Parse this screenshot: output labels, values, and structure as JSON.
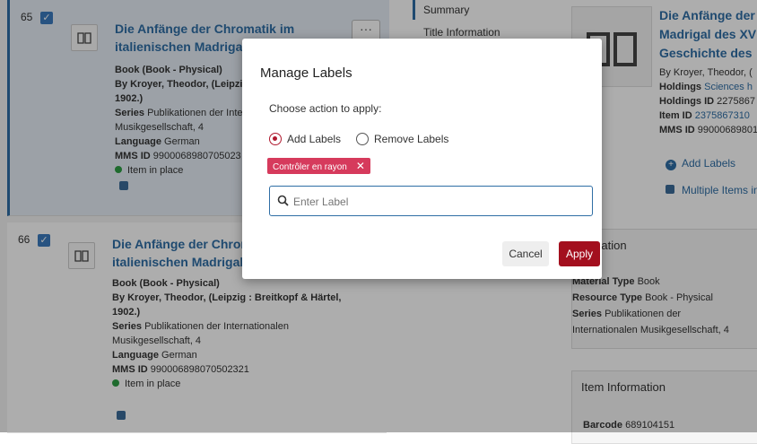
{
  "results": [
    {
      "number": "65",
      "title_line1": "Die Anfänge der Chromatik im",
      "title_line2": "italienischen Madrigal de",
      "line1": "Book (Book - Physical)",
      "line2": "By Kroyer, Theodor, (Leipzig :",
      "line3": "1902.)",
      "series_label": "Series",
      "series_value": "Publikationen der Intern",
      "series_cont": "Musikgesellschaft, 4",
      "language_label": "Language",
      "language_value": "German",
      "mms_label": "MMS ID",
      "mms_value": "9900068980705023",
      "status": "Item in place",
      "more_label": "···"
    },
    {
      "number": "66",
      "title_line1": "Die Anfänge der Chromat",
      "title_line2": "italienischen Madrigal de",
      "line1": "Book (Book - Physical)",
      "line2": "By Kroyer, Theodor, (Leipzig : Breitkopf & Härtel,",
      "line3": "1902.)",
      "series_label": "Series",
      "series_value": "Publikationen der Internationalen",
      "series_cont": "Musikgesellschaft, 4",
      "language_label": "Language",
      "language_value": "German",
      "mms_label": "MMS ID",
      "mms_value": "990006898070502321",
      "status": "Item in place"
    }
  ],
  "menu": {
    "items": [
      "Summary",
      "Title Information"
    ]
  },
  "detail": {
    "title_line1": "Die Anfänge der",
    "title_line2": "Madrigal des XV",
    "title_line3": "Geschichte des",
    "by_line": "By Kroyer, Theodor, (",
    "holdings_label": "Holdings",
    "holdings_value": "Sciences h",
    "holdings_id_label": "Holdings ID",
    "holdings_id_value": "2275867",
    "item_id_label": "Item ID",
    "item_id_value": "2375867310",
    "mms_label": "MMS ID",
    "mms_value": "99000689801",
    "add_labels": "Add Labels",
    "multiple_items": "Multiple Items in",
    "title_info_panel": {
      "heading": "ormation",
      "material_label": "Material Type",
      "material_value": "Book",
      "resource_label": "Resource Type",
      "resource_value": "Book - Physical",
      "series_label": "Series",
      "series_value": "Publikationen der",
      "series_cont": "Internationalen Musikgesellschaft, 4"
    },
    "item_info_panel": {
      "heading": "Item Information",
      "barcode_label": "Barcode",
      "barcode_value": "689104151"
    }
  },
  "modal": {
    "title": "Manage Labels",
    "subtitle": "Choose action to apply:",
    "option_add": "Add Labels",
    "option_remove": "Remove Labels",
    "selected_option": "add",
    "chip_label": "Contrôler en rayon",
    "chip_remove": "✕",
    "input_placeholder": "Enter Label",
    "cancel": "Cancel",
    "apply": "Apply"
  },
  "colors": {
    "accent": "#2f6ea5",
    "apply": "#a30f1e",
    "chip": "#d63a5c",
    "status_ok": "#2e9e45"
  }
}
